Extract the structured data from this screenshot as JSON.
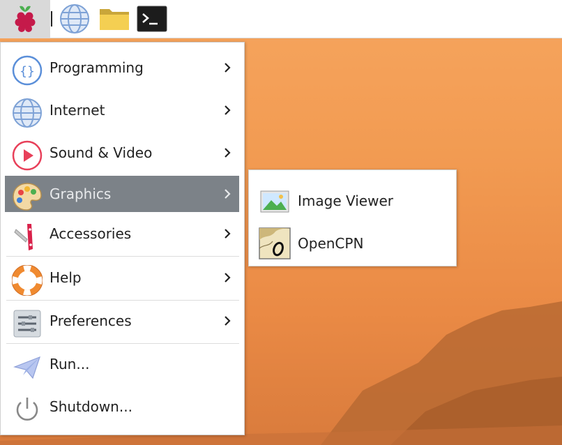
{
  "taskbar": {
    "menu_icon": "raspberry-icon",
    "launchers": [
      {
        "name": "web-browser",
        "icon": "globe-icon"
      },
      {
        "name": "file-manager",
        "icon": "folder-icon"
      },
      {
        "name": "terminal",
        "icon": "terminal-icon"
      }
    ]
  },
  "menu": {
    "items": [
      {
        "label": "Programming",
        "icon": "code-braces-icon"
      },
      {
        "label": "Internet",
        "icon": "globe-icon"
      },
      {
        "label": "Sound & Video",
        "icon": "play-icon"
      },
      {
        "label": "Graphics",
        "icon": "palette-icon",
        "active": true
      },
      {
        "label": "Accessories",
        "icon": "pocket-knife-icon"
      },
      {
        "label": "Help",
        "icon": "lifebuoy-icon"
      },
      {
        "label": "Preferences",
        "icon": "sliders-icon"
      },
      {
        "label": "Run...",
        "icon": "paper-plane-icon"
      },
      {
        "label": "Shutdown...",
        "icon": "power-icon"
      }
    ]
  },
  "submenu": {
    "items": [
      {
        "label": "Image Viewer",
        "icon": "image-icon"
      },
      {
        "label": "OpenCPN",
        "icon": "nautical-chart-icon"
      }
    ]
  },
  "colors": {
    "active_bg": "#7c8288",
    "desktop_top": "#f6a55e",
    "desktop_hill": "#b86a33"
  }
}
